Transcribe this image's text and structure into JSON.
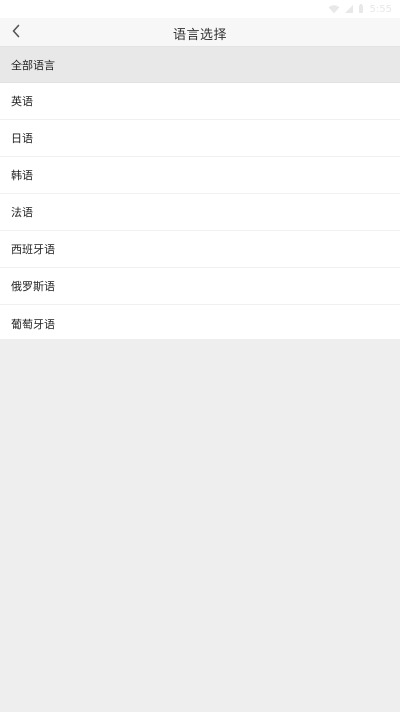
{
  "status_bar": {
    "time": "5:55",
    "icons": [
      "wifi-icon",
      "signal-icon",
      "battery-icon"
    ]
  },
  "header": {
    "back_icon": "chevron-left-icon",
    "title": "语言选择"
  },
  "list": {
    "header_label": "全部语言",
    "items": [
      {
        "label": "英语"
      },
      {
        "label": "日语"
      },
      {
        "label": "韩语"
      },
      {
        "label": "法语"
      },
      {
        "label": "西班牙语"
      },
      {
        "label": "俄罗斯语"
      },
      {
        "label": "葡萄牙语"
      }
    ]
  },
  "colors": {
    "background": "#eeeeee",
    "top_bar": "#f7f7f7",
    "section_header": "#e8e8e8",
    "text": "#222222"
  }
}
